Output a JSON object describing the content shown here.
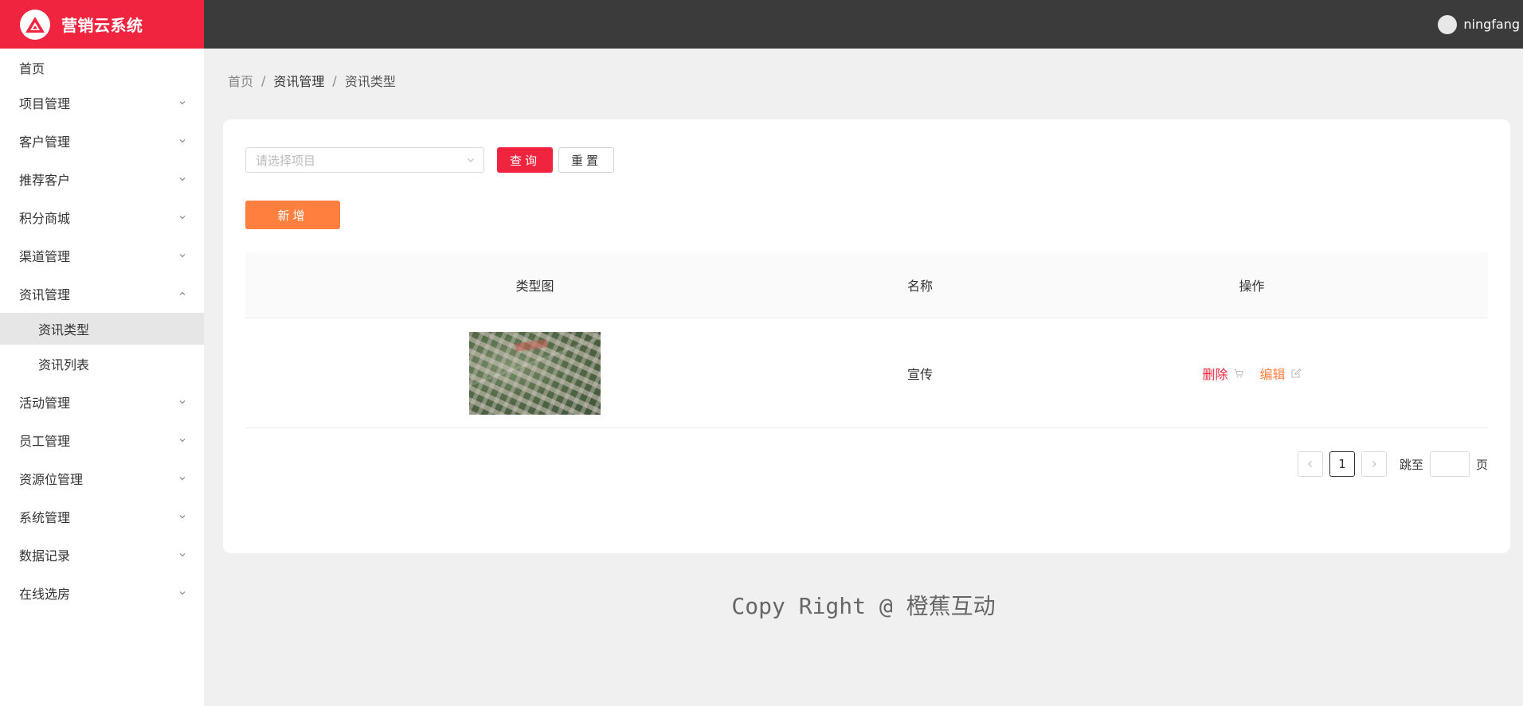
{
  "brand": {
    "title": "营销云系统"
  },
  "header": {
    "username": "ningfang"
  },
  "sidebar": {
    "home": "首页",
    "items": [
      {
        "label": "项目管理"
      },
      {
        "label": "客户管理"
      },
      {
        "label": "推荐客户"
      },
      {
        "label": "积分商城"
      },
      {
        "label": "渠道管理"
      },
      {
        "label": "资讯管理",
        "expanded": true,
        "children": [
          {
            "label": "资讯类型",
            "active": true
          },
          {
            "label": "资讯列表"
          }
        ]
      },
      {
        "label": "活动管理"
      },
      {
        "label": "员工管理"
      },
      {
        "label": "资源位管理"
      },
      {
        "label": "系统管理"
      },
      {
        "label": "数据记录"
      },
      {
        "label": "在线选房"
      }
    ]
  },
  "breadcrumb": {
    "home": "首页",
    "section": "资讯管理",
    "current": "资讯类型",
    "separator": "/"
  },
  "filter": {
    "project_placeholder": "请选择项目",
    "query_label": "查询",
    "reset_label": "重置"
  },
  "toolbar": {
    "add_label": "新增"
  },
  "table": {
    "headers": {
      "image": "类型图",
      "name": "名称",
      "actions": "操作"
    },
    "rows": [
      {
        "image": "aerial-building-photo",
        "name": "宣传",
        "delete": "删除",
        "edit": "编辑"
      }
    ]
  },
  "pagination": {
    "current": "1",
    "jump_label": "跳至",
    "page_suffix": "页"
  },
  "footer": {
    "text": "Copy Right @ 橙蕉互动"
  },
  "colors": {
    "brand": "#f0243e",
    "header": "#3b3b3b",
    "accent_orange": "#ff7f3f"
  }
}
